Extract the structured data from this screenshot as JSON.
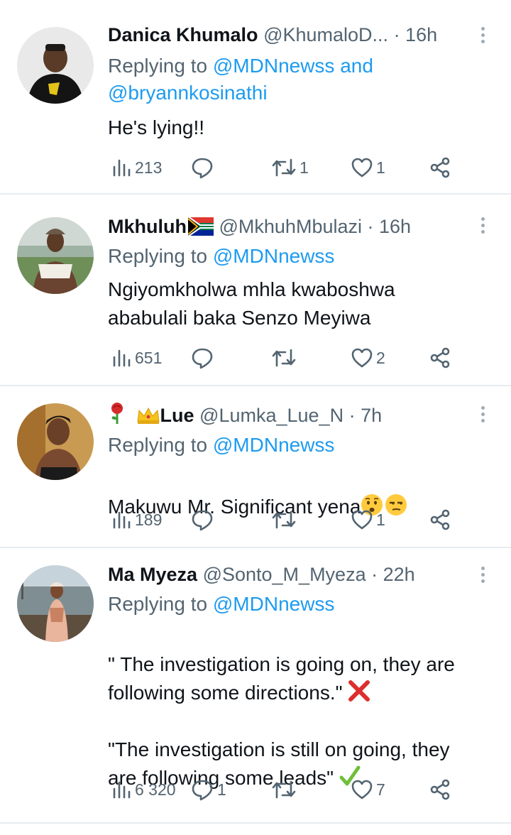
{
  "tweets": [
    {
      "name": "Danica Khumalo",
      "handle": "@KhumaloD...",
      "time": "· 16h",
      "reply_prefix": "Replying to",
      "reply_line1": "@MDNnewss and",
      "reply_line2": "@bryannkosinathi",
      "text": "He's lying!!",
      "views": "213",
      "replies": "",
      "retweets": "1",
      "likes": "1"
    },
    {
      "name": "Mkhuluh",
      "handle": "@MkhuhMbulazi",
      "time": "· 16h",
      "reply_prefix": "Replying to",
      "reply_line1": "@MDNnewss",
      "text": "Ngiyomkholwa mhla kwaboshwa\nababulali baka Senzo Meyiwa",
      "views": "651",
      "replies": "",
      "retweets": "",
      "likes": "2"
    },
    {
      "name": "Lue",
      "handle": "@Lumka_Lue_N",
      "time": "· 7h",
      "reply_prefix": "Replying to",
      "reply_line1": "@MDNnewss",
      "text": "Makuwu Mr. Significant yena",
      "views": "189",
      "replies": "",
      "retweets": "",
      "likes": "1"
    },
    {
      "name": "Ma Myeza",
      "handle": "@Sonto_M_Myeza",
      "time": "· 22h",
      "reply_prefix": "Replying to",
      "reply_line1": "@MDNnewss",
      "text_p1": "\" The investigation is going on, they are\nfollowing some directions.\"",
      "text_p2": "\"The investigation is still on going, they\nare following some leads\"",
      "views": "6 320",
      "replies": "1",
      "retweets": "",
      "likes": "7"
    }
  ],
  "colors": {
    "link": "#1d9bf0",
    "muted": "#536471",
    "separator": "#e6ecf0"
  }
}
